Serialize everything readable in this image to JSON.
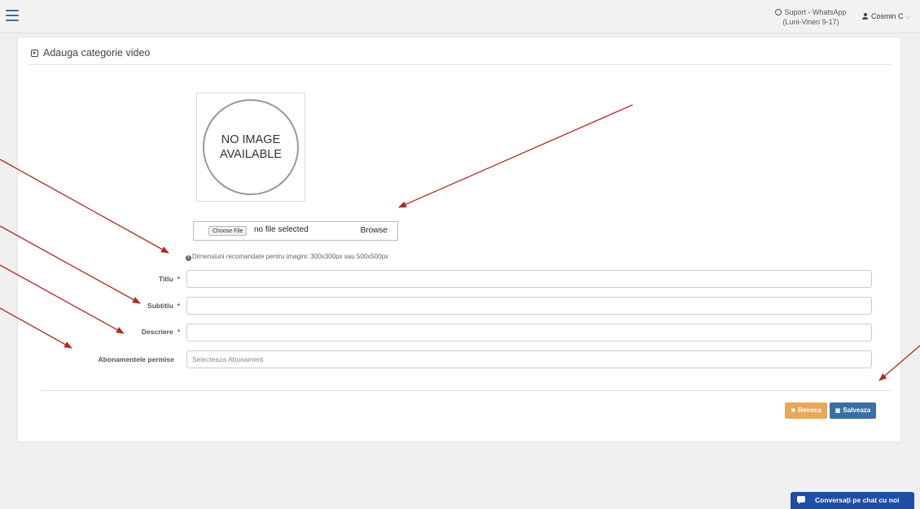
{
  "topbar": {
    "support_line1": "Suport - WhatsApp",
    "support_line2": "(Luni-Vineri 9-17)",
    "user_name": "Cosmin C"
  },
  "card": {
    "title": "Adauga categorie video",
    "no_image_line1": "NO IMAGE",
    "no_image_line2": "AVAILABLE",
    "file_input": {
      "choose_label": "Choose File",
      "status": "no file selected",
      "browse_label": "Browse"
    },
    "hint": "Dimensiuni recomandate pentru imagini: 300x300px sau 500x500px",
    "fields": {
      "titlu": {
        "label": "Titlu",
        "required_mark": "*",
        "value": ""
      },
      "subtitlu": {
        "label": "Subtitlu",
        "required_mark": "*",
        "value": ""
      },
      "descriere": {
        "label": "Descriere",
        "required_mark": "*",
        "value": ""
      },
      "abonamente": {
        "label": "Abonamentele permise",
        "placeholder": "Selecteaza Abonament"
      }
    },
    "buttons": {
      "cancel": "Revoca",
      "save": "Salveaza"
    }
  },
  "chat": {
    "label": "Conversați pe chat cu noi"
  },
  "colors": {
    "accent": "#3a6ea5",
    "cancel": "#e8a85a",
    "chat": "#1e4fa8",
    "arrow": "#b02a25",
    "required": "#c0392b"
  }
}
